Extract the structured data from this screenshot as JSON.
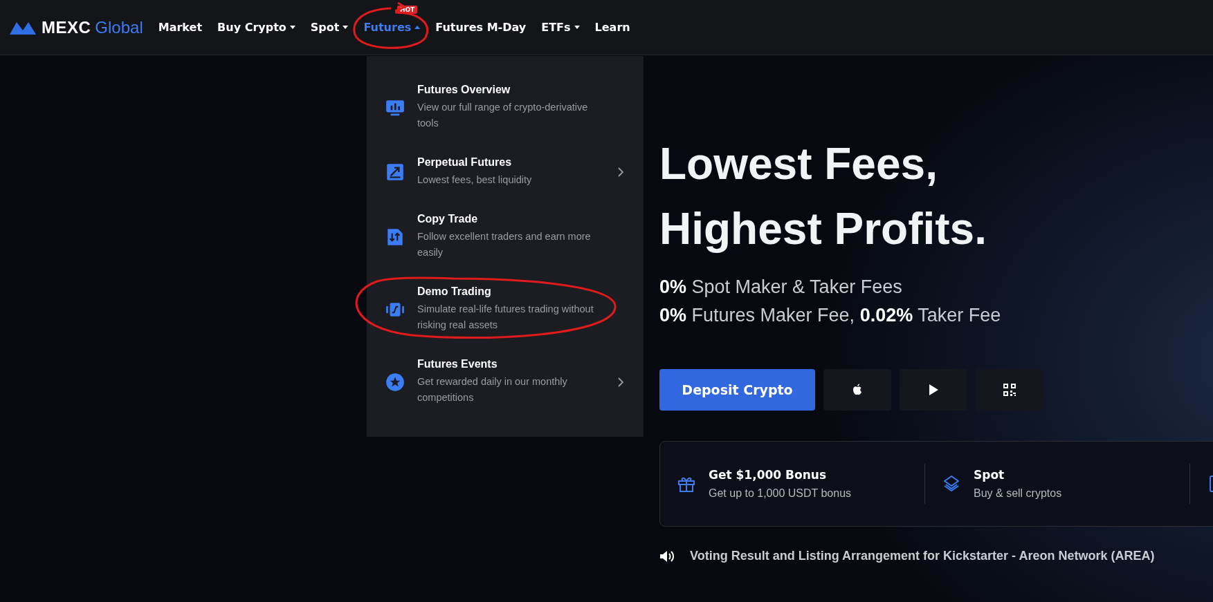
{
  "header": {
    "logo": {
      "brand": "MEXC",
      "suffix": "Global"
    },
    "nav": [
      {
        "label": "Market",
        "dropdown": false,
        "selected": false
      },
      {
        "label": "Buy Crypto",
        "dropdown": true,
        "selected": false
      },
      {
        "label": "Spot",
        "dropdown": true,
        "selected": false
      },
      {
        "label": "Futures",
        "dropdown": true,
        "selected": true,
        "badge": "HOT"
      },
      {
        "label": "Futures M-Day",
        "dropdown": false,
        "selected": false
      },
      {
        "label": "ETFs",
        "dropdown": true,
        "selected": false
      },
      {
        "label": "Learn",
        "dropdown": false,
        "selected": false
      }
    ]
  },
  "futures_menu": [
    {
      "kind": "overview",
      "title": "Futures Overview",
      "description": "View our full range of crypto-derivative tools",
      "submenu": false
    },
    {
      "kind": "perpetual",
      "title": "Perpetual Futures",
      "description": "Lowest fees, best liquidity",
      "submenu": true
    },
    {
      "kind": "copy",
      "title": "Copy Trade",
      "description": "Follow excellent traders and earn more easily",
      "submenu": false
    },
    {
      "kind": "demo",
      "title": "Demo Trading",
      "description": "Simulate real-life futures trading without risking real assets",
      "submenu": false
    },
    {
      "kind": "events",
      "title": "Futures Events",
      "description": "Get rewarded daily in our monthly competitions",
      "submenu": true
    }
  ],
  "hero": {
    "headline": [
      "Lowest Fees,",
      "Highest Profits."
    ],
    "fees": [
      "**0%** Spot Maker & Taker Fees",
      "**0%** Futures Maker Fee, **0.02%** Taker Fee"
    ],
    "deposit_button": "Deposit Crypto"
  },
  "features": [
    {
      "kind": "gift",
      "title": "Get $1,000 Bonus",
      "subtitle": "Get up to 1,000 USDT bonus"
    },
    {
      "kind": "layers",
      "title": "Spot",
      "subtitle": "Buy & sell cryptos"
    }
  ],
  "announcement": "Voting Result and Listing Arrangement for Kickstarter - Areon Network (AREA)"
}
